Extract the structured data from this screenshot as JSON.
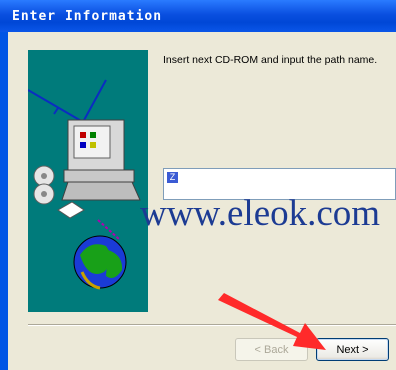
{
  "window": {
    "title": "Enter Information"
  },
  "instruction": "Insert next CD-ROM and input the path name.",
  "path_field": {
    "value": ""
  },
  "watermark": "www.eleok.com",
  "buttons": {
    "back": "< Back",
    "next": "Next >"
  },
  "colors": {
    "titlebar": "#0a4fe0",
    "art_background": "#007b7b",
    "arrow": "#ff2a2a",
    "watermark": "#1c3b93"
  }
}
